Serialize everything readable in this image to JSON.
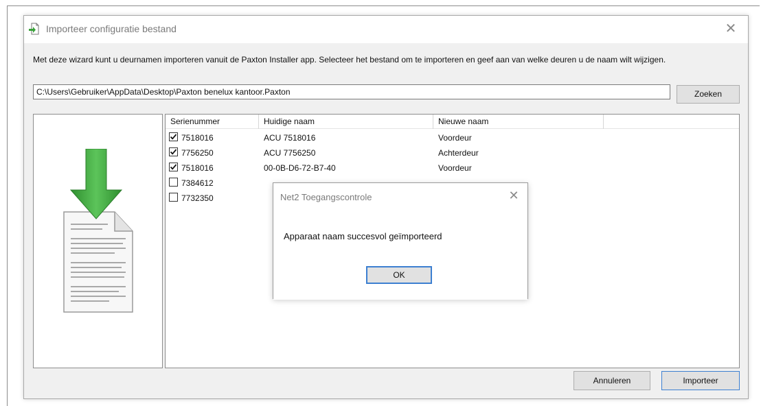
{
  "dialog": {
    "title": "Importeer configuratie bestand",
    "description": "Met deze wizard kunt u deurnamen importeren vanuit de Paxton Installer app. Selecteer het bestand om te importeren en geef aan van welke deuren u de naam wilt wijzigen.",
    "file_path": "C:\\Users\\Gebruiker\\AppData\\Desktop\\Paxton benelux kantoor.Paxton",
    "search_label": "Zoeken",
    "cancel_label": "Annuleren",
    "import_label": "Importeer"
  },
  "table": {
    "columns": [
      "Serienummer",
      "Huidige naam",
      "Nieuwe naam"
    ],
    "rows": [
      {
        "checked": true,
        "serial": "7518016",
        "current": "ACU 7518016",
        "new": "Voordeur"
      },
      {
        "checked": true,
        "serial": "7756250",
        "current": "ACU 7756250",
        "new": "Achterdeur"
      },
      {
        "checked": true,
        "serial": "7518016",
        "current": "00-0B-D6-72-B7-40",
        "new": "Voordeur"
      },
      {
        "checked": false,
        "serial": "7384612",
        "current": "",
        "new": ""
      },
      {
        "checked": false,
        "serial": "7732350",
        "current": "",
        "new": ""
      }
    ]
  },
  "messagebox": {
    "title": "Net2 Toegangscontrole",
    "message": "Apparaat naam succesvol geïmporteerd",
    "ok_label": "OK"
  },
  "icons": {
    "title_icon": "import-file-icon",
    "illustration": "document-download-icon",
    "close": "close-icon"
  },
  "colors": {
    "arrow_green": "#3aa13a",
    "focus_blue": "#3c7fd1",
    "dialog_bg": "#f0f0f0"
  }
}
